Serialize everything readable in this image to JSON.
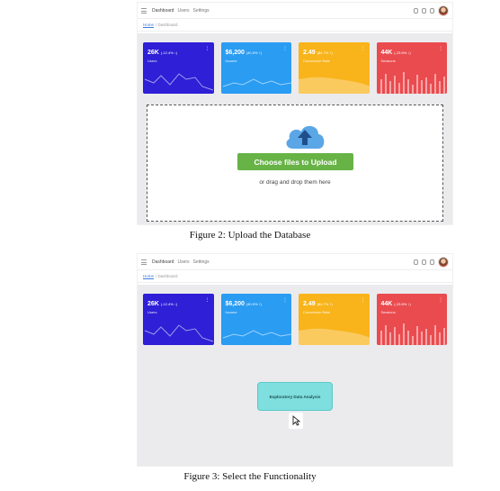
{
  "nav": {
    "items": [
      "Dashboard",
      "Users",
      "Settings"
    ]
  },
  "breadcrumb": {
    "home": "Home",
    "current": "Dashboard"
  },
  "cards": [
    {
      "value": "26K",
      "delta": "(-12.4% ↓)",
      "label": "Users",
      "color": "#2f1fd6"
    },
    {
      "value": "$6,200",
      "delta": "(40.9% ↑)",
      "label": "Income",
      "color": "#2a9cf2"
    },
    {
      "value": "2.49",
      "delta": "(84.7% ↑)",
      "label": "Conversion Rate",
      "color": "#f8b41a"
    },
    {
      "value": "44K",
      "delta": "(-23.6% ↓)",
      "label": "Sessions",
      "color": "#ea4b4f"
    }
  ],
  "upload": {
    "button": "Choose files to Upload",
    "hint": "or drag and drop them here"
  },
  "captions": {
    "fig2": "Figure 2: Upload the Database",
    "fig3": "Figure 3: Select the Functionality"
  },
  "functionality": {
    "button": "Exploratory Data Analysis"
  },
  "icons": [
    "menu-icon",
    "bell-icon",
    "grid-icon",
    "lock-icon",
    "avatar",
    "kebab-icon",
    "cloud-upload-icon",
    "mouse-cursor-icon"
  ]
}
